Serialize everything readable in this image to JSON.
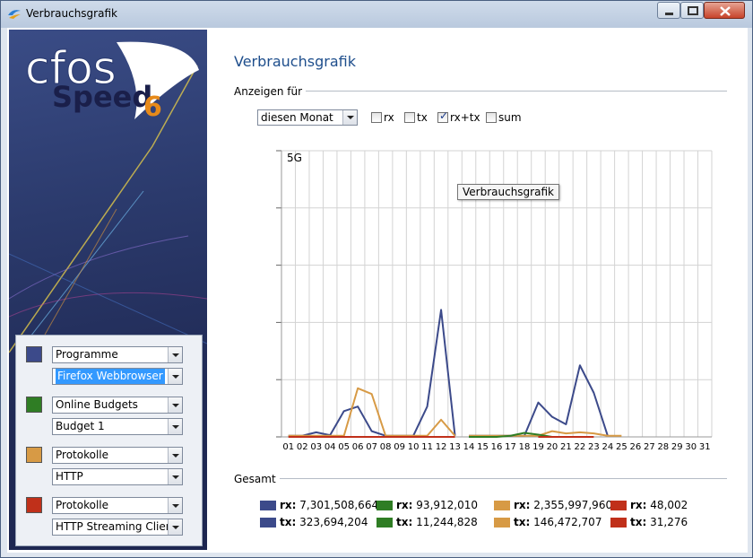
{
  "window": {
    "title": "Verbrauchsgrafik"
  },
  "logo": {
    "word1": "cfos",
    "word2": "Speed",
    "version": "6"
  },
  "filters": [
    {
      "color": "#3c4a8a",
      "category": "Programme",
      "item": "Firefox Webbrowser",
      "item_selected": true
    },
    {
      "color": "#2f7d24",
      "category": "Online Budgets",
      "item": "Budget 1",
      "item_selected": false
    },
    {
      "color": "#d79a45",
      "category": "Protokolle",
      "item": "HTTP",
      "item_selected": false
    },
    {
      "color": "#c0301a",
      "category": "Protokolle",
      "item": "HTTP Streaming Client",
      "item_selected": false
    }
  ],
  "page": {
    "heading": "Verbrauchsgrafik",
    "show_for_label": "Anzeigen für",
    "period": "diesen Monat",
    "checkboxes": [
      {
        "label": "rx",
        "checked": false
      },
      {
        "label": "tx",
        "checked": false
      },
      {
        "label": "rx+tx",
        "checked": true
      },
      {
        "label": "sum",
        "checked": false
      }
    ],
    "tooltip": "Verbrauchsgrafik",
    "total_label": "Gesamt"
  },
  "totals": [
    {
      "color": "#3c4a8a",
      "rx": "7,301,508,664",
      "tx": "323,694,204"
    },
    {
      "color": "#2f7d24",
      "rx": "93,912,010",
      "tx": "11,244,828"
    },
    {
      "color": "#d79a45",
      "rx": "2,355,997,960",
      "tx": "146,472,707"
    },
    {
      "color": "#c0301a",
      "rx": "48,002",
      "tx": "31,276"
    }
  ],
  "totals_labels": {
    "rx": "rx:",
    "tx": "tx:"
  },
  "chart_data": {
    "type": "line",
    "ymax_label": "5G",
    "ylim": [
      0,
      5
    ],
    "grid": true,
    "categories": [
      "01",
      "02",
      "03",
      "04",
      "05",
      "06",
      "07",
      "08",
      "09",
      "10",
      "11",
      "12",
      "13",
      "14",
      "15",
      "16",
      "17",
      "18",
      "19",
      "20",
      "21",
      "22",
      "23",
      "24",
      "25",
      "26",
      "27",
      "28",
      "29",
      "30",
      "31"
    ],
    "series": [
      {
        "color": "#3c4a8a",
        "segments": [
          {
            "days": [
              1,
              2,
              3,
              4,
              5,
              6,
              7,
              8,
              9,
              10,
              11,
              12,
              13
            ],
            "values": [
              0.02,
              0.02,
              0.08,
              0.03,
              0.45,
              0.53,
              0.1,
              0.02,
              0.02,
              0.02,
              0.53,
              2.22,
              0.02
            ]
          },
          {
            "days": [
              14,
              15,
              16,
              17,
              18,
              19,
              20,
              21,
              22,
              23,
              24
            ],
            "values": [
              0.02,
              0.02,
              0.02,
              0.02,
              0.02,
              0.6,
              0.35,
              0.22,
              1.25,
              0.77,
              0.02
            ]
          }
        ]
      },
      {
        "color": "#d79a45",
        "segments": [
          {
            "days": [
              1,
              2,
              3,
              4,
              5,
              6,
              7,
              8,
              9,
              10,
              11,
              12,
              13
            ],
            "values": [
              0.02,
              0.02,
              0.02,
              0.02,
              0.02,
              0.85,
              0.75,
              0.02,
              0.02,
              0.02,
              0.02,
              0.3,
              0.02
            ]
          },
          {
            "days": [
              14,
              15,
              16,
              17,
              18,
              19,
              20,
              21,
              22,
              23,
              24,
              25
            ],
            "values": [
              0.02,
              0.02,
              0.02,
              0.02,
              0.02,
              0.02,
              0.1,
              0.06,
              0.08,
              0.06,
              0.02,
              0.02
            ]
          }
        ]
      },
      {
        "color": "#2f7d24",
        "segments": [
          {
            "days": [
              14,
              15,
              16,
              17,
              18,
              19,
              20
            ],
            "values": [
              0.0,
              0.0,
              0.0,
              0.02,
              0.07,
              0.04,
              0.0
            ]
          }
        ]
      },
      {
        "color": "#c0301a",
        "segments": [
          {
            "days": [
              1,
              2,
              3,
              4,
              5,
              6,
              7,
              8,
              9,
              10,
              11,
              12,
              13
            ],
            "values": [
              0.0,
              0.0,
              0.0,
              0.0,
              0.0,
              0.0,
              0.0,
              0.0,
              0.0,
              0.0,
              0.0,
              0.0,
              0.0
            ]
          },
          {
            "days": [
              19,
              20,
              21,
              22,
              23
            ],
            "values": [
              0.0,
              0.0,
              0.0,
              0.0,
              0.0
            ]
          }
        ]
      }
    ]
  }
}
